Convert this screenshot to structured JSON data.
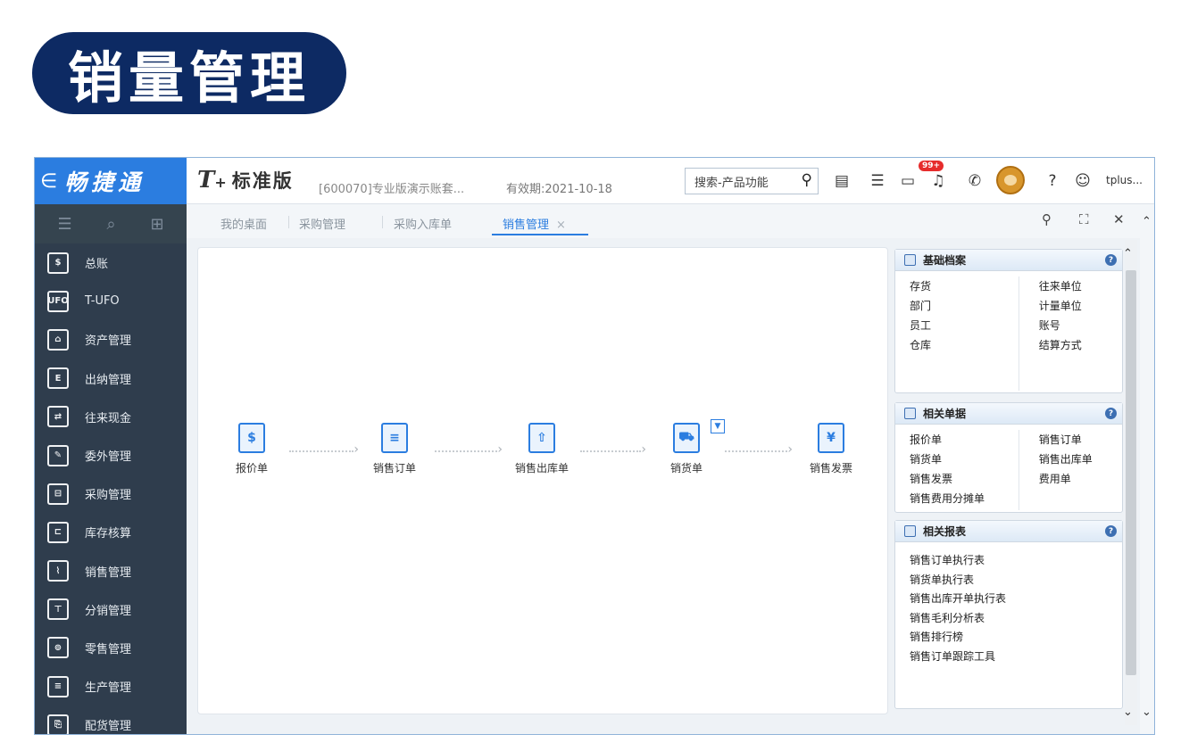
{
  "banner": {
    "title": "销量管理"
  },
  "header": {
    "brand_arrow": "∈",
    "brand_name": "畅捷通",
    "edition_t": "T",
    "edition_plus": "+",
    "edition_name": "标准版",
    "account": "[600070]专业版演示账套...",
    "validity": "有效期:2021-10-18",
    "search_placeholder": "搜索-产品功能",
    "badge": "99+",
    "user": "tplus..."
  },
  "tabs": [
    {
      "label": "我的桌面"
    },
    {
      "label": "采购管理"
    },
    {
      "label": "采购入库单"
    },
    {
      "label": "销售管理",
      "active": true
    }
  ],
  "tab_close": "×",
  "sidebar": {
    "items": [
      {
        "label": "总账",
        "icon": "ledger-icon"
      },
      {
        "label": "T-UFO",
        "icon": "ufo-report-icon"
      },
      {
        "label": "资产管理",
        "icon": "bank-building-icon"
      },
      {
        "label": "出纳管理",
        "icon": "cashier-icon"
      },
      {
        "label": "往来现金",
        "icon": "cash-flow-icon"
      },
      {
        "label": "委外管理",
        "icon": "outsourcing-icon"
      },
      {
        "label": "采购管理",
        "icon": "purchase-icon"
      },
      {
        "label": "库存核算",
        "icon": "inventory-icon"
      },
      {
        "label": "销售管理",
        "icon": "sales-chart-icon"
      },
      {
        "label": "分销管理",
        "icon": "org-tree-icon"
      },
      {
        "label": "零售管理",
        "icon": "retail-icon"
      },
      {
        "label": "生产管理",
        "icon": "production-icon"
      },
      {
        "label": "配货管理",
        "icon": "distribution-icon"
      }
    ]
  },
  "flow": [
    {
      "label": "报价单",
      "icon": "quotation-icon"
    },
    {
      "label": "销售订单",
      "icon": "sales-order-icon"
    },
    {
      "label": "销售出库单",
      "icon": "outbound-box-icon"
    },
    {
      "label": "销货单",
      "icon": "cart-icon"
    },
    {
      "label": "销售发票",
      "icon": "invoice-icon"
    }
  ],
  "panels": {
    "basic": {
      "title": "基础档案",
      "left": [
        "存货",
        "部门",
        "员工",
        "仓库"
      ],
      "right": [
        "往来单位",
        "计量单位",
        "账号",
        "结算方式"
      ]
    },
    "docs": {
      "title": "相关单据",
      "left": [
        "报价单",
        "销货单",
        "销售发票",
        "销售费用分摊单"
      ],
      "right": [
        "销售订单",
        "销售出库单",
        "费用单"
      ]
    },
    "reports": {
      "title": "相关报表",
      "items": [
        "销售订单执行表",
        "销货单执行表",
        "销售出库开单执行表",
        "销售毛利分析表",
        "销售排行榜",
        "销售订单跟踪工具"
      ]
    }
  },
  "colors": {
    "brand": "#2b7de0",
    "sidebar": "#2f3d4d",
    "banner": "#0d2a63",
    "badge": "#e62c2c"
  }
}
